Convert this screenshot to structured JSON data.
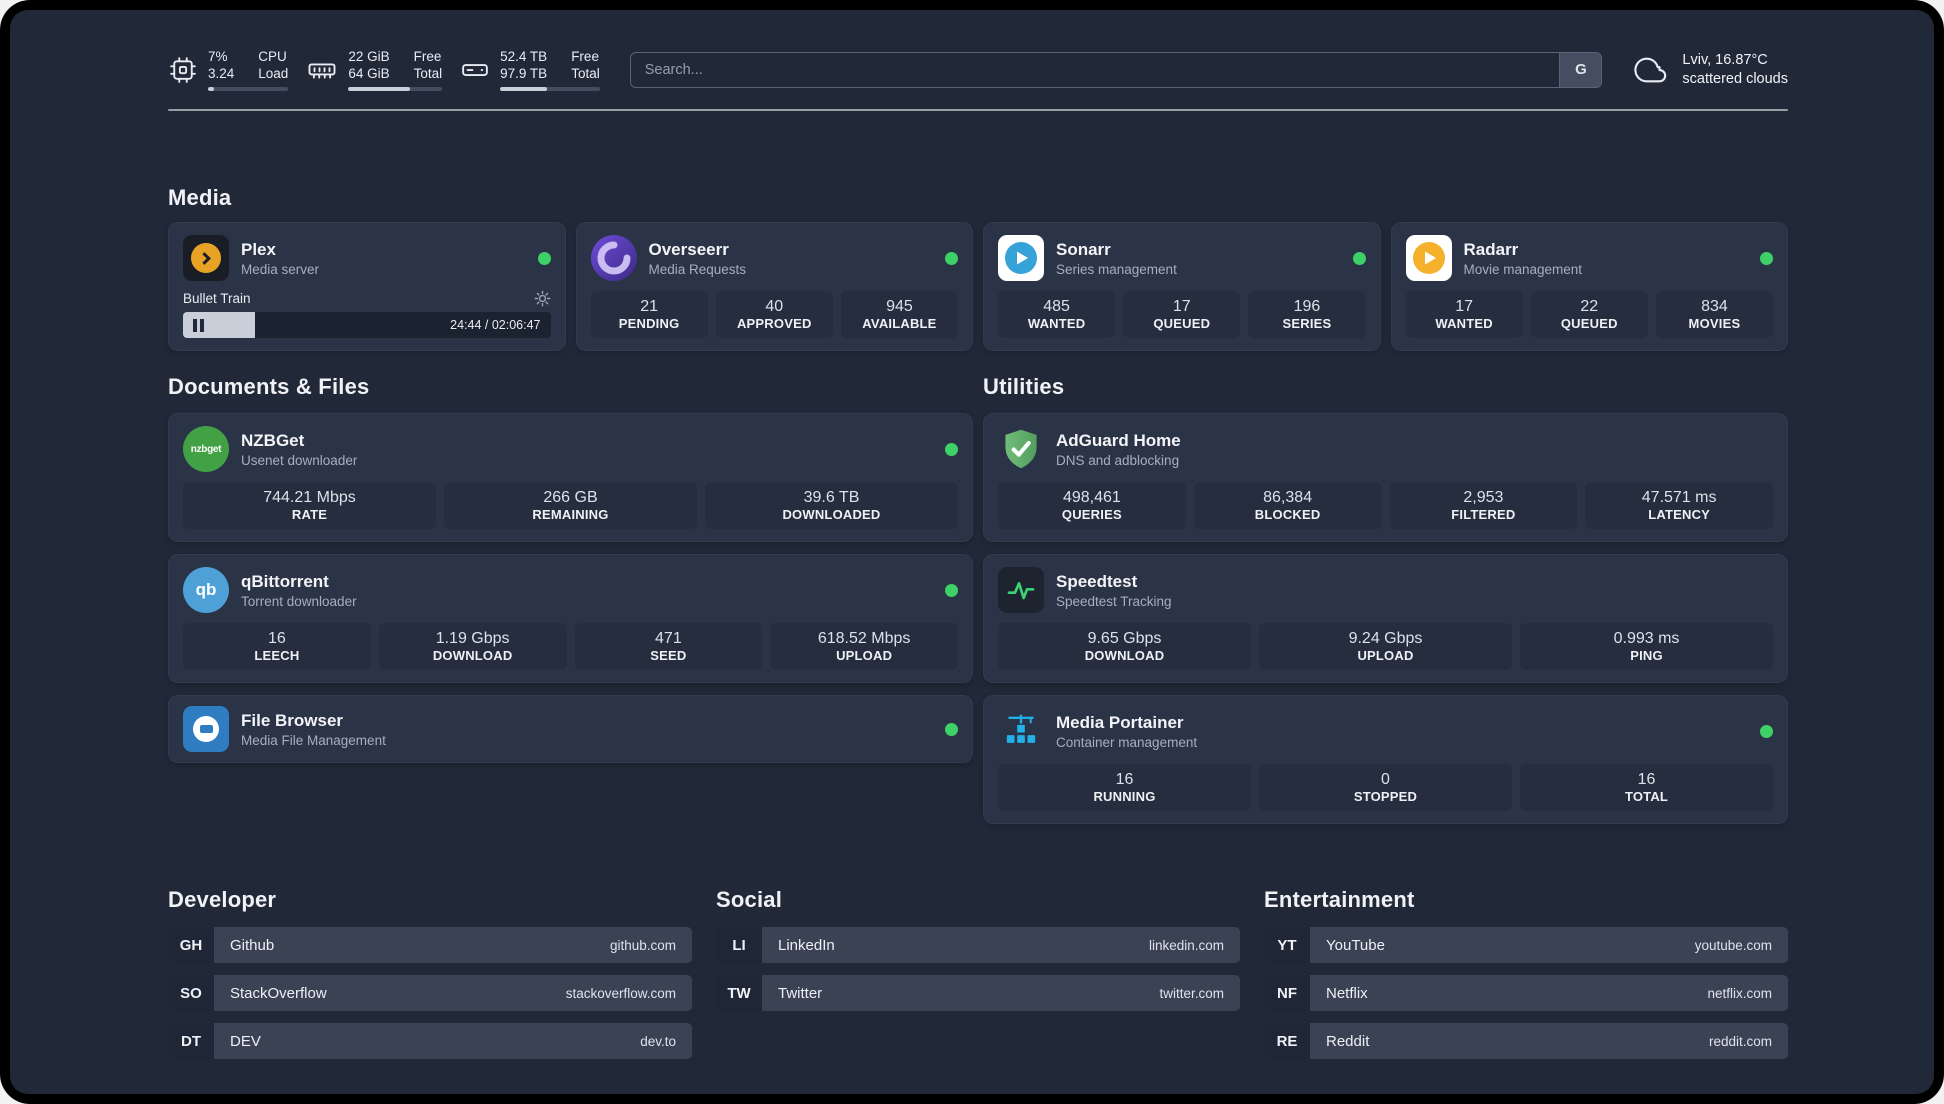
{
  "topbar": {
    "cpu": {
      "usage": "7%",
      "load": "3.24",
      "label_top": "CPU",
      "label_bottom": "Load",
      "bar_percent": 7
    },
    "memory": {
      "free": "22 GiB",
      "total": "64 GiB",
      "label_top": "Free",
      "label_bottom": "Total",
      "bar_percent": 66
    },
    "storage": {
      "free": "52.4 TB",
      "total": "97.9 TB",
      "label_top": "Free",
      "label_bottom": "Total",
      "bar_percent": 47
    },
    "search": {
      "placeholder": "Search...",
      "engine_label": "G"
    },
    "weather": {
      "location": "Lviv, 16.87°C",
      "condition": "scattered clouds"
    }
  },
  "sections": {
    "media": {
      "heading": "Media",
      "plex": {
        "name": "Plex",
        "subtitle": "Media server",
        "now_playing": {
          "title": "Bullet Train",
          "time_display": "24:44 / 02:06:47",
          "progress_percent": 19.5
        }
      },
      "overseerr": {
        "name": "Overseerr",
        "subtitle": "Media Requests",
        "stats": [
          {
            "value": "21",
            "label": "PENDING"
          },
          {
            "value": "40",
            "label": "APPROVED"
          },
          {
            "value": "945",
            "label": "AVAILABLE"
          }
        ]
      },
      "sonarr": {
        "name": "Sonarr",
        "subtitle": "Series management",
        "stats": [
          {
            "value": "485",
            "label": "WANTED"
          },
          {
            "value": "17",
            "label": "QUEUED"
          },
          {
            "value": "196",
            "label": "SERIES"
          }
        ]
      },
      "radarr": {
        "name": "Radarr",
        "subtitle": "Movie management",
        "stats": [
          {
            "value": "17",
            "label": "WANTED"
          },
          {
            "value": "22",
            "label": "QUEUED"
          },
          {
            "value": "834",
            "label": "MOVIES"
          }
        ]
      }
    },
    "documents": {
      "heading": "Documents & Files",
      "nzbget": {
        "name": "NZBGet",
        "subtitle": "Usenet downloader",
        "stats": [
          {
            "value": "744.21 Mbps",
            "label": "RATE"
          },
          {
            "value": "266 GB",
            "label": "REMAINING"
          },
          {
            "value": "39.6 TB",
            "label": "DOWNLOADED"
          }
        ]
      },
      "qbittorrent": {
        "name": "qBittorrent",
        "subtitle": "Torrent downloader",
        "stats": [
          {
            "value": "16",
            "label": "LEECH"
          },
          {
            "value": "1.19 Gbps",
            "label": "DOWNLOAD"
          },
          {
            "value": "471",
            "label": "SEED"
          },
          {
            "value": "618.52 Mbps",
            "label": "UPLOAD"
          }
        ]
      },
      "filebrowser": {
        "name": "File Browser",
        "subtitle": "Media File Management"
      }
    },
    "utilities": {
      "heading": "Utilities",
      "adguard": {
        "name": "AdGuard Home",
        "subtitle": "DNS and adblocking",
        "stats": [
          {
            "value": "498,461",
            "label": "QUERIES"
          },
          {
            "value": "86,384",
            "label": "BLOCKED"
          },
          {
            "value": "2,953",
            "label": "FILTERED"
          },
          {
            "value": "47.571 ms",
            "label": "LATENCY"
          }
        ]
      },
      "speedtest": {
        "name": "Speedtest",
        "subtitle": "Speedtest Tracking",
        "stats": [
          {
            "value": "9.65 Gbps",
            "label": "DOWNLOAD"
          },
          {
            "value": "9.24 Gbps",
            "label": "UPLOAD"
          },
          {
            "value": "0.993 ms",
            "label": "PING"
          }
        ]
      },
      "portainer": {
        "name": "Media Portainer",
        "subtitle": "Container management",
        "stats": [
          {
            "value": "16",
            "label": "RUNNING"
          },
          {
            "value": "0",
            "label": "STOPPED"
          },
          {
            "value": "16",
            "label": "TOTAL"
          }
        ]
      }
    }
  },
  "bookmarks": {
    "developer": {
      "heading": "Developer",
      "items": [
        {
          "badge": "GH",
          "name": "Github",
          "url": "github.com"
        },
        {
          "badge": "SO",
          "name": "StackOverflow",
          "url": "stackoverflow.com"
        },
        {
          "badge": "DT",
          "name": "DEV",
          "url": "dev.to"
        }
      ]
    },
    "social": {
      "heading": "Social",
      "items": [
        {
          "badge": "LI",
          "name": "LinkedIn",
          "url": "linkedin.com"
        },
        {
          "badge": "TW",
          "name": "Twitter",
          "url": "twitter.com"
        }
      ]
    },
    "entertainment": {
      "heading": "Entertainment",
      "items": [
        {
          "badge": "YT",
          "name": "YouTube",
          "url": "youtube.com"
        },
        {
          "badge": "NF",
          "name": "Netflix",
          "url": "netflix.com"
        },
        {
          "badge": "RE",
          "name": "Reddit",
          "url": "reddit.com"
        }
      ]
    }
  },
  "icons": {
    "nzbget_label": "nzbget",
    "qbittorrent_label": "qb"
  },
  "colors": {
    "background": "#212939",
    "card": "#2b3346",
    "stat_tile": "#252d3e",
    "status_online": "#3ed168",
    "plex_gold": "#e8a326",
    "adguard_green": "#5fae6a",
    "portainer_blue": "#22b1e7",
    "speedtest_green": "#3bd375"
  }
}
